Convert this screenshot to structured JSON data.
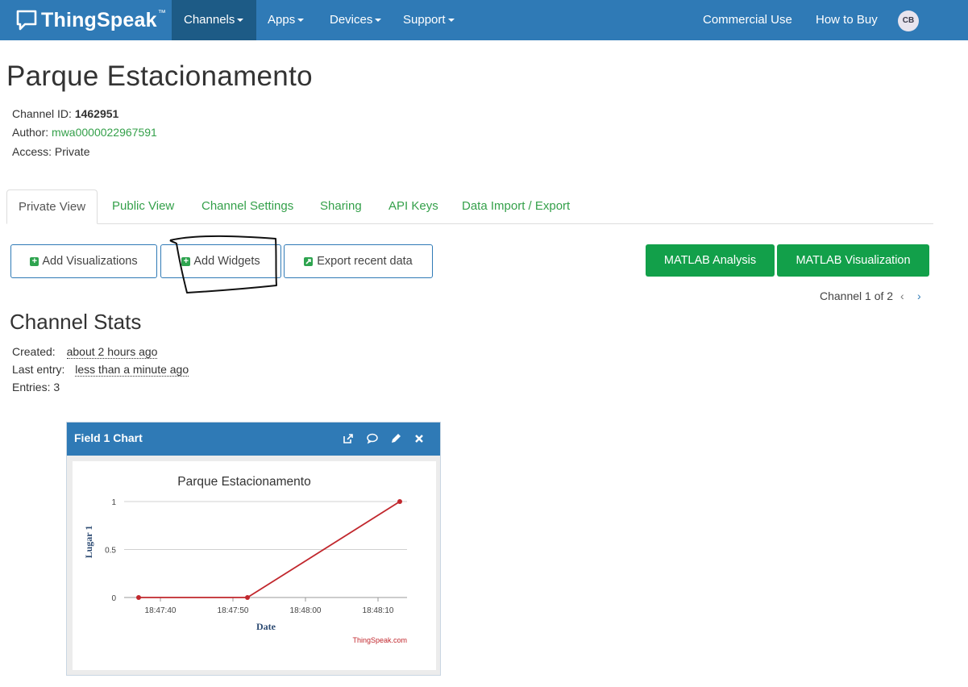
{
  "navbar": {
    "brand": "ThingSpeak",
    "brand_tm": "™",
    "items": [
      {
        "label": "Channels",
        "dropdown": true
      },
      {
        "label": "Apps",
        "dropdown": true
      },
      {
        "label": "Devices",
        "dropdown": true
      },
      {
        "label": "Support",
        "dropdown": true
      }
    ],
    "commercial": "Commercial Use",
    "how_to_buy": "How to Buy",
    "avatar": "CB"
  },
  "channel": {
    "title": "Parque Estacionamento",
    "id_label": "Channel ID:",
    "id_value": "1462951",
    "author_label": "Author:",
    "author_value": "mwa0000022967591",
    "access": "Access: Private"
  },
  "tabs": [
    "Private View",
    "Public View",
    "Channel Settings",
    "Sharing",
    "API Keys",
    "Data Import / Export"
  ],
  "buttons": {
    "add_visualizations": "Add Visualizations",
    "add_widgets": "Add Widgets",
    "export_recent": "Export recent data",
    "matlab_analysis": "MATLAB Analysis",
    "matlab_visualization": "MATLAB Visualization"
  },
  "pager": "Channel 1 of 2",
  "stats": {
    "title": "Channel Stats",
    "created_label": "Created:",
    "created_value": "about 2 hours ago",
    "last_label": "Last entry:",
    "last_value": "less than a minute ago",
    "entries": "Entries: 3"
  },
  "widget": {
    "title": "Field 1 Chart",
    "icons": [
      "external-link-icon",
      "comment-icon",
      "pencil-icon",
      "close-icon"
    ]
  },
  "colors": {
    "nav": "#2f7ab6",
    "nav_active": "#1d5b86",
    "green": "#12a04a",
    "link": "#34a04a",
    "series": "#c1272d"
  },
  "chart_data": {
    "type": "line",
    "title": "Parque Estacionamento",
    "xlabel": "Date",
    "ylabel": "Lugar 1",
    "credit": "ThingSpeak.com",
    "x": [
      "18:47:37",
      "18:47:52",
      "18:48:13"
    ],
    "series": [
      {
        "values": [
          0,
          0,
          1
        ]
      }
    ],
    "x_ticks": [
      "18:47:40",
      "18:47:50",
      "18:48:00",
      "18:48:10"
    ],
    "y_ticks": [
      "0",
      "0.5",
      "1"
    ],
    "ylim": [
      0,
      1
    ],
    "grid": true
  }
}
